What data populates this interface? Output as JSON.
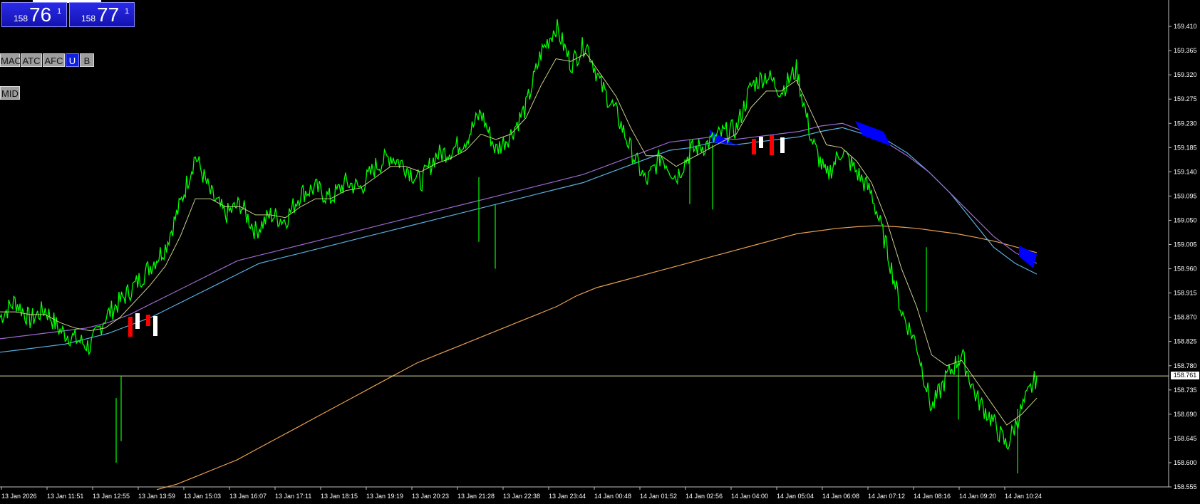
{
  "quotes": {
    "bid": {
      "prefix": "158",
      "big": "76",
      "sup": "1"
    },
    "ask": {
      "prefix": "158",
      "big": "77",
      "sup": "1"
    }
  },
  "buttons": {
    "mac": "MAC",
    "atc": "ATC",
    "afc": "AFC",
    "u": "U",
    "b": "B",
    "mid": "MID"
  },
  "current_price": "158.761",
  "colors": {
    "background": "#000000",
    "price_line": "#00ff00",
    "ma_fast": "#c8d08a",
    "ma_purple": "#9a6ad0",
    "ma_blue": "#5ab0e0",
    "ma_orange": "#e8a050",
    "cloud_down": "#0000ff",
    "cloud_up": "#ff0000",
    "button_active": "#1020e0"
  },
  "chart_data": {
    "type": "line",
    "ylim": [
      158.555,
      159.455
    ],
    "y_ticks": [
      "159.410",
      "159.365",
      "159.320",
      "159.275",
      "159.230",
      "159.185",
      "159.140",
      "159.095",
      "159.050",
      "159.005",
      "158.960",
      "158.915",
      "158.870",
      "158.825",
      "158.780",
      "158.735",
      "158.690",
      "158.645",
      "158.600",
      "158.555"
    ],
    "x_ticks": [
      "13 Jan 2026",
      "13 Jan 11:51",
      "13 Jan 12:55",
      "13 Jan 13:59",
      "13 Jan 15:03",
      "13 Jan 16:07",
      "13 Jan 17:11",
      "13 Jan 18:15",
      "13 Jan 19:19",
      "13 Jan 20:23",
      "13 Jan 21:28",
      "13 Jan 22:38",
      "13 Jan 23:44",
      "14 Jan 00:48",
      "14 Jan 01:52",
      "14 Jan 02:56",
      "14 Jan 04:00",
      "14 Jan 05:04",
      "14 Jan 06:08",
      "14 Jan 07:12",
      "14 Jan 08:16",
      "14 Jan 09:20",
      "14 Jan 10:24"
    ],
    "series": [
      {
        "values": [
          158.87,
          158.9,
          158.865,
          158.885,
          158.845,
          158.83,
          158.815,
          158.87,
          158.9,
          158.93,
          158.965,
          159.0,
          159.08,
          159.17,
          159.1,
          159.06,
          159.08,
          159.03,
          159.06,
          159.05,
          159.1,
          159.11,
          159.09,
          159.12,
          159.11,
          159.15,
          159.17,
          159.15,
          159.12,
          159.17,
          159.18,
          159.2,
          159.25,
          159.18,
          159.21,
          159.26,
          159.36,
          159.41,
          159.34,
          159.38,
          159.3,
          159.25,
          159.18,
          159.12,
          159.17,
          159.13,
          159.18,
          159.19,
          159.21,
          159.22,
          159.3,
          159.32,
          159.29,
          159.33,
          159.2,
          159.13,
          159.18,
          159.14,
          159.1,
          159.0,
          158.88,
          158.82,
          158.7,
          158.76,
          158.8,
          158.72,
          158.68,
          158.63,
          158.7,
          158.761
        ]
      },
      {
        "values": [
          158.88,
          158.88,
          158.875,
          158.875,
          158.86,
          158.85,
          158.845,
          158.85,
          158.87,
          158.9,
          158.93,
          158.965,
          159.02,
          159.09,
          159.09,
          159.075,
          159.075,
          159.06,
          159.06,
          159.055,
          159.075,
          159.09,
          159.09,
          159.105,
          159.11,
          159.13,
          159.15,
          159.15,
          159.14,
          159.155,
          159.165,
          159.18,
          159.21,
          159.2,
          159.21,
          159.24,
          159.3,
          159.35,
          159.345,
          159.36,
          159.32,
          159.28,
          159.22,
          159.17,
          159.17,
          159.15,
          159.165,
          159.18,
          159.195,
          159.21,
          159.26,
          159.29,
          159.29,
          159.31,
          159.25,
          159.19,
          159.185,
          159.16,
          159.12,
          159.05,
          158.96,
          158.89,
          158.8,
          158.78,
          158.79,
          158.75,
          158.71,
          158.67,
          158.69,
          158.72
        ]
      },
      {
        "values": [
          158.83,
          158.835,
          158.84,
          158.845,
          158.85,
          158.86,
          158.875,
          158.895,
          158.915,
          158.935,
          158.955,
          158.975,
          158.985,
          158.995,
          159.005,
          159.015,
          159.025,
          159.035,
          159.045,
          159.055,
          159.065,
          159.075,
          159.085,
          159.095,
          159.105,
          159.115,
          159.125,
          159.135,
          159.15,
          159.165,
          159.18,
          159.195,
          159.2,
          159.205,
          159.2,
          159.205,
          159.21,
          159.215,
          159.225,
          159.23,
          159.215,
          159.195,
          159.17,
          159.14,
          159.1,
          159.06,
          159.02,
          158.99,
          158.97
        ]
      },
      {
        "values": [
          158.805,
          158.81,
          158.815,
          158.82,
          158.83,
          158.84,
          158.855,
          158.87,
          158.89,
          158.91,
          158.93,
          158.95,
          158.97,
          158.98,
          158.99,
          159.0,
          159.01,
          159.02,
          159.03,
          159.04,
          159.05,
          159.06,
          159.07,
          159.08,
          159.09,
          159.1,
          159.11,
          159.12,
          159.135,
          159.15,
          159.165,
          159.18,
          159.185,
          159.195,
          159.19,
          159.195,
          159.2,
          159.205,
          159.215,
          159.222,
          159.21,
          159.2,
          159.175,
          159.14,
          159.1,
          159.05,
          159.0,
          158.97,
          158.95
        ]
      },
      {
        "values": [
          158.55,
          158.56,
          158.575,
          158.59,
          158.605,
          158.625,
          158.645,
          158.665,
          158.685,
          158.705,
          158.725,
          158.745,
          158.765,
          158.785,
          158.8,
          158.815,
          158.83,
          158.845,
          158.86,
          158.875,
          158.89,
          158.91,
          158.925,
          158.935,
          158.945,
          158.955,
          158.965,
          158.975,
          158.985,
          158.995,
          159.005,
          159.015,
          159.025,
          159.03,
          159.035,
          159.038,
          159.04,
          159.038,
          159.035,
          159.03,
          159.025,
          159.018,
          159.01,
          159.0,
          158.99
        ]
      }
    ]
  }
}
